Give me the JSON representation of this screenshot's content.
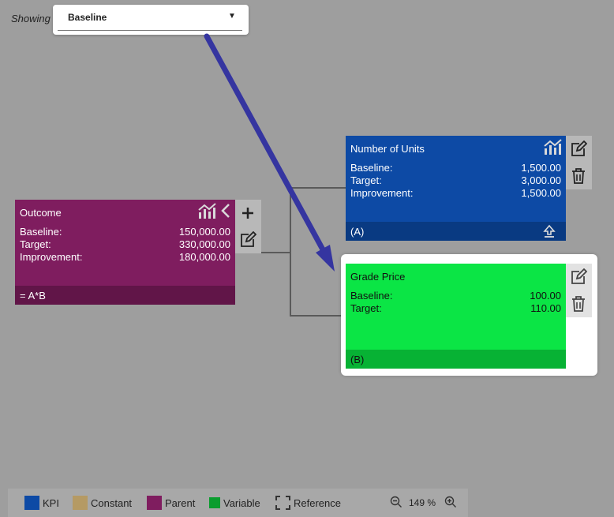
{
  "toolbar": {
    "showing_label": "Showing",
    "scenario_value": "Baseline"
  },
  "nodes": {
    "outcome": {
      "title": "Outcome",
      "rows": [
        {
          "label": "Baseline:",
          "value": "150,000.00"
        },
        {
          "label": "Target:",
          "value": "330,000.00"
        },
        {
          "label": "Improvement:",
          "value": "180,000.00"
        }
      ],
      "formula": "= A*B",
      "color": "#7f1d5f"
    },
    "units": {
      "title": "Number of Units",
      "rows": [
        {
          "label": "Baseline:",
          "value": "1,500.00"
        },
        {
          "label": "Target:",
          "value": "3,000.00"
        },
        {
          "label": "Improvement:",
          "value": "1,500.00"
        }
      ],
      "tag": "(A)",
      "color": "#0d4aa5"
    },
    "grade": {
      "title": "Grade Price",
      "rows": [
        {
          "label": "Baseline:",
          "value": "100.00"
        },
        {
          "label": "Target:",
          "value": "110.00"
        }
      ],
      "tag": "(B)",
      "color": "#0be545"
    }
  },
  "annotation": {
    "arrow_color": "#3535a0"
  },
  "legend": {
    "items": [
      {
        "label": "KPI",
        "color": "#0d4aa5"
      },
      {
        "label": "Constant",
        "color": "#b59a64"
      },
      {
        "label": "Parent",
        "color": "#7f1d5f"
      },
      {
        "label": "Variable",
        "color": "#0a9d2e"
      },
      {
        "label": "Reference",
        "color": ""
      }
    ],
    "zoom": "149 %"
  }
}
